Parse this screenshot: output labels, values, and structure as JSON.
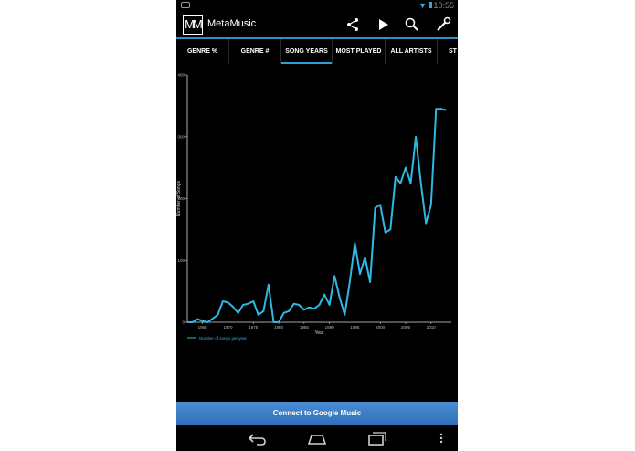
{
  "status": {
    "time": "10:55"
  },
  "app": {
    "title": "MetaMusic",
    "logo_text": "MM"
  },
  "action_icons": [
    "share-icon",
    "play-icon",
    "search-icon",
    "wrench-icon"
  ],
  "tabs": [
    {
      "label": "GENRE %"
    },
    {
      "label": "GENRE #"
    },
    {
      "label": "SONG YEARS",
      "active": true
    },
    {
      "label": "MOST PLAYED"
    },
    {
      "label": "ALL ARTISTS"
    },
    {
      "label": "ST"
    }
  ],
  "chart_data": {
    "type": "line",
    "xlabel": "Year",
    "ylabel": "Number of Songs",
    "xlim": [
      1962,
      2014
    ],
    "ylim": [
      0,
      400
    ],
    "x_ticks": [
      1965,
      1970,
      1975,
      1980,
      1985,
      1990,
      1995,
      2000,
      2005,
      2010
    ],
    "y_ticks": [
      0,
      100,
      200,
      300,
      400
    ],
    "grid": false,
    "legend_position": "bottom-left",
    "series": [
      {
        "name": "Number of songs per year",
        "color": "#2fb8e6",
        "x": [
          1962,
          1963,
          1964,
          1965,
          1966,
          1967,
          1968,
          1969,
          1970,
          1971,
          1972,
          1973,
          1974,
          1975,
          1976,
          1977,
          1978,
          1979,
          1980,
          1981,
          1982,
          1983,
          1984,
          1985,
          1986,
          1987,
          1988,
          1989,
          1990,
          1991,
          1992,
          1993,
          1994,
          1995,
          1996,
          1997,
          1998,
          1999,
          2000,
          2001,
          2002,
          2003,
          2004,
          2005,
          2006,
          2007,
          2008,
          2009,
          2010,
          2011,
          2012,
          2013
        ],
        "y": [
          0,
          0,
          5,
          2,
          0,
          6,
          12,
          34,
          32,
          25,
          15,
          28,
          30,
          34,
          12,
          18,
          61,
          0,
          0,
          15,
          18,
          30,
          28,
          20,
          24,
          22,
          28,
          45,
          28,
          75,
          40,
          12,
          65,
          128,
          78,
          105,
          65,
          185,
          190,
          145,
          150,
          235,
          225,
          250,
          225,
          300,
          225,
          160,
          190,
          345,
          345,
          343
        ]
      }
    ]
  },
  "connect_button": {
    "label": "Connect to Google Music"
  },
  "nav_icons": [
    "back-icon",
    "home-icon",
    "recents-icon",
    "menu-icon"
  ]
}
